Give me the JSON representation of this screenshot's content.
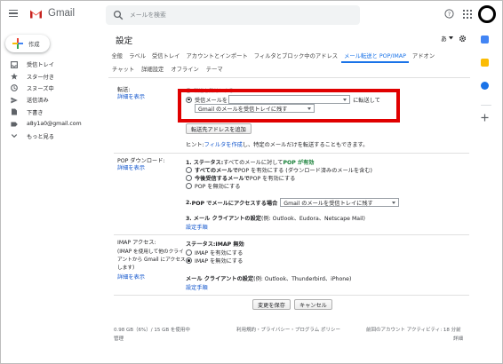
{
  "header": {
    "app_name": "Gmail",
    "search_placeholder": "メールを検索"
  },
  "nav": {
    "compose": "作成",
    "items": [
      {
        "label": "受信トレイ",
        "icon": "inbox-icon"
      },
      {
        "label": "スター付き",
        "icon": "star-icon"
      },
      {
        "label": "スヌーズ中",
        "icon": "clock-icon"
      },
      {
        "label": "送信済み",
        "icon": "send-icon"
      },
      {
        "label": "下書き",
        "icon": "draft-icon"
      },
      {
        "label": "a8y1a0@gmail.com",
        "icon": "label-icon"
      },
      {
        "label": "もっと見る",
        "icon": "chevron-down-icon"
      }
    ]
  },
  "settings": {
    "title": "設定",
    "language": "あ",
    "tabs_row1": [
      "全般",
      "ラベル",
      "受信トレイ",
      "アカウントとインポート",
      "フィルタとブロック中のアドレス",
      "メール転送と POP/IMAP",
      "アドオン"
    ],
    "active_tab": "メール転送と POP/IMAP",
    "tabs_row2": [
      "チャット",
      "詳細設定",
      "オフライン",
      "テーマ"
    ]
  },
  "forwarding": {
    "label": "転送:",
    "more_link": "詳細を表示",
    "disable_option_partial": "転送を無効にする",
    "forward_to": "受信メールを",
    "forward_suffix": "に転送して",
    "forward_select": "",
    "action_select": "Gmail のメールを受信トレイに残す",
    "add_address_button": "転送先アドレスを追加",
    "hint_prefix": "ヒント: ",
    "hint_link": "フィルタを作成",
    "hint_suffix": "し、特定のメールだけを転送することもできます。"
  },
  "pop": {
    "label": "POP ダウンロード:",
    "more_link": "詳細を表示",
    "status_prefix": "1. ステータス: ",
    "status_mid": "すべてのメールに対して ",
    "status_value": "POP が有効",
    "opt1_bold": "すべてのメールで",
    "opt1_rest": " POP を有効にする (ダウンロード済みのメールを含む)",
    "opt2_bold": "今後受信するメールで",
    "opt2_rest": " POP を有効にする",
    "opt3": "POP を無効にする",
    "step2_prefix": "2. ",
    "step2_bold": "POP でメールにアクセスする場合",
    "step2_select": "Gmail のメールを受信トレイに残す",
    "step3_bold": "3. メール クライアントの設定",
    "step3_rest": " (例: Outlook、Eudora、Netscape Mail)",
    "setup_link": "設定手順"
  },
  "imap": {
    "label": "IMAP アクセス:",
    "desc": [
      "(IMAP を使用して他のクライ",
      "アントから Gmail にアクセス",
      "します)"
    ],
    "more_link": "詳細を表示",
    "status_prefix": "ステータス: ",
    "status_value": "IMAP 無効",
    "opt_enable": "IMAP を有効にする",
    "opt_disable": "IMAP を無効にする",
    "client_bold": "メール クライアントの設定",
    "client_rest": " (例: Outlook、Thunderbird、iPhone)",
    "setup_link": "設定手順"
  },
  "actions": {
    "save": "変更を保存",
    "cancel": "キャンセル"
  },
  "footer": {
    "storage": "0.98 GB（6%）/ 15 GB を使用中",
    "manage": "管理",
    "terms": "利用規約・プライバシー・プログラム ポリシー",
    "activity": "前回のアカウント アクティビティ: 18 分前",
    "details": "詳細"
  },
  "colors": {
    "accent": "#1a73e8",
    "highlight_border": "#e00000",
    "pop_enabled": "#188038"
  }
}
